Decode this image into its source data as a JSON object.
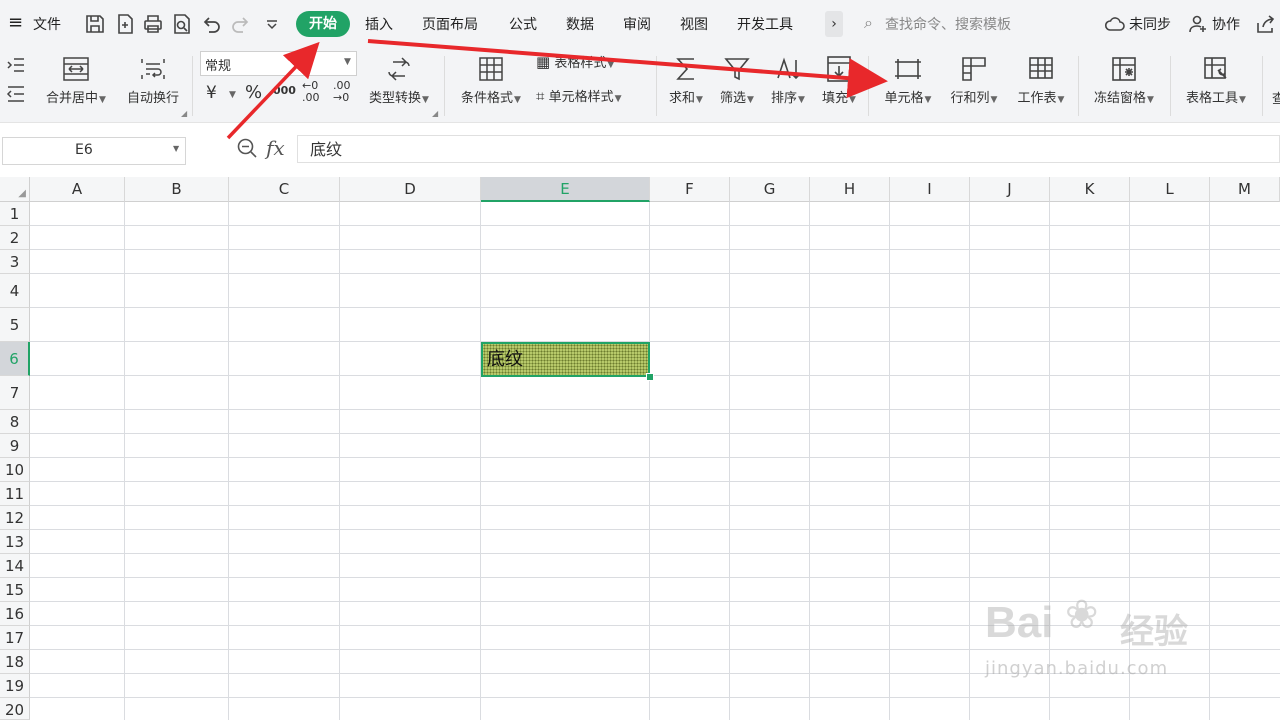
{
  "menu": {
    "file_label": "文件",
    "tabs": [
      "开始",
      "插入",
      "页面布局",
      "公式",
      "数据",
      "审阅",
      "视图",
      "开发工具"
    ],
    "more": "›",
    "search_placeholder": "查找命令、搜索模板",
    "sync_label": "未同步",
    "collab_label": "协作"
  },
  "ribbon": {
    "merge_center": "合并居中",
    "auto_wrap": "自动换行",
    "number_format": "常规",
    "currency_symbol": "¥",
    "percent_symbol": "%",
    "thousands_symbol": "000",
    "dec_increase": "←0 .00",
    "dec_decrease": ".00 →0",
    "type_convert": "类型转换",
    "cond_format": "条件格式",
    "table_style": "表格样式",
    "cell_style": "单元格样式",
    "sum": "求和",
    "filter": "筛选",
    "sort": "排序",
    "fill": "填充",
    "cell": "单元格",
    "row_col": "行和列",
    "sheet": "工作表",
    "freeze": "冻结窗格",
    "table_tools": "表格工具",
    "cut_off_label": "查"
  },
  "formula_bar": {
    "name_box": "E6",
    "fx_label": "fx",
    "content": "底纹"
  },
  "grid": {
    "columns": [
      "A",
      "B",
      "C",
      "D",
      "E",
      "F",
      "G",
      "H",
      "I",
      "J",
      "K",
      "L",
      "M"
    ],
    "rows": [
      "1",
      "2",
      "3",
      "4",
      "5",
      "6",
      "7",
      "8",
      "9",
      "10",
      "11",
      "12",
      "13",
      "14",
      "15",
      "16",
      "17",
      "18",
      "19",
      "20"
    ],
    "active_column": "E",
    "active_row": "6",
    "cell_e6": "底纹"
  },
  "watermark": {
    "brand": "Bai",
    "brand_suffix": "经验",
    "url": "jingyan.baidu.com"
  },
  "colors": {
    "accent": "#21a366",
    "annotation_arrow": "#e8282b",
    "cell_fill": "#b7c96a"
  }
}
